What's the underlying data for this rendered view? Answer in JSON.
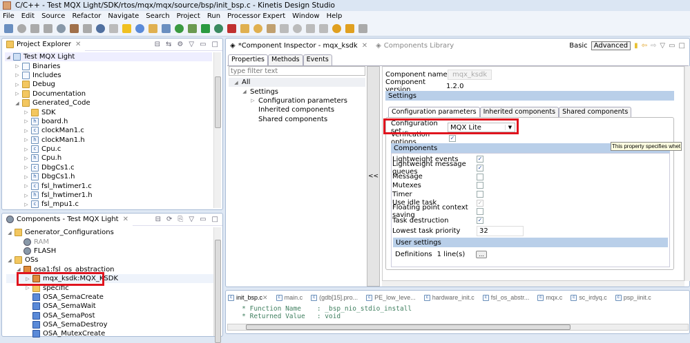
{
  "window": {
    "title": "C/C++ - Test MQX Light/SDK/rtos/mqx/mqx/source/bsp/init_bsp.c - Kinetis Design Studio"
  },
  "menu": [
    "File",
    "Edit",
    "Source",
    "Refactor",
    "Navigate",
    "Search",
    "Project",
    "Run",
    "Processor Expert",
    "Window",
    "Help"
  ],
  "project_explorer": {
    "title": "Project Explorer",
    "items": [
      {
        "label": "Test MQX Light",
        "depth": 0,
        "tw": "◢",
        "icon": "project"
      },
      {
        "label": "Binaries",
        "depth": 1,
        "tw": "▷",
        "icon": "binaries"
      },
      {
        "label": "Includes",
        "depth": 1,
        "tw": "▷",
        "icon": "includes"
      },
      {
        "label": "Debug",
        "depth": 1,
        "tw": "▷",
        "icon": "folder"
      },
      {
        "label": "Documentation",
        "depth": 1,
        "tw": "▷",
        "icon": "folder"
      },
      {
        "label": "Generated_Code",
        "depth": 1,
        "tw": "◢",
        "icon": "folder"
      },
      {
        "label": "SDK",
        "depth": 2,
        "tw": "▷",
        "icon": "folder"
      },
      {
        "label": "board.h",
        "depth": 2,
        "tw": "▷",
        "icon": "h"
      },
      {
        "label": "clockMan1.c",
        "depth": 2,
        "tw": "▷",
        "icon": "c"
      },
      {
        "label": "clockMan1.h",
        "depth": 2,
        "tw": "▷",
        "icon": "h"
      },
      {
        "label": "Cpu.c",
        "depth": 2,
        "tw": "▷",
        "icon": "c"
      },
      {
        "label": "Cpu.h",
        "depth": 2,
        "tw": "▷",
        "icon": "h"
      },
      {
        "label": "DbgCs1.c",
        "depth": 2,
        "tw": "▷",
        "icon": "c"
      },
      {
        "label": "DbgCs1.h",
        "depth": 2,
        "tw": "▷",
        "icon": "h"
      },
      {
        "label": "fsl_hwtimer1.c",
        "depth": 2,
        "tw": "▷",
        "icon": "c"
      },
      {
        "label": "fsl_hwtimer1.h",
        "depth": 2,
        "tw": "▷",
        "icon": "h"
      },
      {
        "label": "fsl_mpu1.c",
        "depth": 2,
        "tw": "▷",
        "icon": "c"
      }
    ]
  },
  "components_view": {
    "title": "Components - Test MQX Light",
    "items": [
      {
        "label": "Generator_Configurations",
        "depth": 0,
        "tw": "◢",
        "icon": "folder"
      },
      {
        "label": "RAM",
        "depth": 1,
        "tw": "",
        "icon": "gear",
        "disabled": true
      },
      {
        "label": "FLASH",
        "depth": 1,
        "tw": "",
        "icon": "gear"
      },
      {
        "label": "OSs",
        "depth": 0,
        "tw": "◢",
        "icon": "folder"
      },
      {
        "label": "osa1:fsl_os_abstraction",
        "depth": 1,
        "tw": "◢",
        "icon": "os"
      },
      {
        "label": "mqx_ksdk:MQX_KSDK",
        "depth": 2,
        "tw": "▷",
        "icon": "os",
        "highlighted": true
      },
      {
        "label": "specific",
        "depth": 2,
        "tw": "▷",
        "icon": "folder"
      },
      {
        "label": "OSA_SemaCreate",
        "depth": 2,
        "tw": "",
        "icon": "osa"
      },
      {
        "label": "OSA_SemaWait",
        "depth": 2,
        "tw": "",
        "icon": "osa"
      },
      {
        "label": "OSA_SemaPost",
        "depth": 2,
        "tw": "",
        "icon": "osa"
      },
      {
        "label": "OSA_SemaDestroy",
        "depth": 2,
        "tw": "",
        "icon": "osa"
      },
      {
        "label": "OSA_MutexCreate",
        "depth": 2,
        "tw": "",
        "icon": "osa"
      }
    ]
  },
  "inspector": {
    "tab_title": "*Component Inspector - mqx_ksdk",
    "library_tab": "Components Library",
    "mode_basic": "Basic",
    "mode_advanced": "Advanced",
    "subtabs": [
      "Properties",
      "Methods",
      "Events"
    ],
    "filter_placeholder": "type filter text",
    "tree": [
      {
        "label": "All",
        "depth": 0,
        "tw": "◢"
      },
      {
        "label": "Settings",
        "depth": 1,
        "tw": "◢"
      },
      {
        "label": "Configuration parameters",
        "depth": 2,
        "tw": "▷"
      },
      {
        "label": "Inherited components",
        "depth": 2,
        "tw": ""
      },
      {
        "label": "Shared components",
        "depth": 2,
        "tw": ""
      }
    ],
    "collapse_label": "<<",
    "component_name_label": "Component name",
    "component_name": "mqx_ksdk",
    "component_version_label": "Component version",
    "component_version": "1.2.0",
    "settings_header": "Settings",
    "settings_tabs": [
      "Configuration parameters",
      "Inherited components",
      "Shared components"
    ],
    "config_set_label": "Configuration set",
    "config_set_value": "MQX Lite",
    "verification_label": "Verification options",
    "verification_checked": true,
    "components_header": "Components",
    "tooltip": "This property specifies whet",
    "options": [
      {
        "label": "Lightweight events",
        "checked": true
      },
      {
        "label": "Lightweight message queues",
        "checked": true
      },
      {
        "label": "Message",
        "checked": false
      },
      {
        "label": "Mutexes",
        "checked": false
      },
      {
        "label": "Timer",
        "checked": false
      },
      {
        "label": "Use idle task",
        "checked": true,
        "disabled": true
      },
      {
        "label": "Floating point context saving",
        "checked": false
      },
      {
        "label": "Task destruction",
        "checked": true
      }
    ],
    "priority_label": "Lowest task priority",
    "priority_value": "32",
    "user_settings_header": "User settings",
    "definitions_label": "Definitions",
    "definitions_value": "1 line(s)",
    "definitions_button": "..."
  },
  "editor": {
    "tabs": [
      "init_bsp.c",
      "main.c",
      "(gdb[15].pro...",
      "PE_low_leve...",
      "hardware_init.c",
      "fsl_os_abstr...",
      "mqx.c",
      "sc_irdyq.c",
      "psp_iinit.c"
    ],
    "lines": [
      "   * Function Name    : _bsp_nio_stdio_install",
      "   * Returned Value   : void"
    ]
  },
  "colors": {
    "highlight_box": "#e0141e",
    "section_header": "#b9cfe9",
    "tooltip_bg": "#ffffe1"
  }
}
